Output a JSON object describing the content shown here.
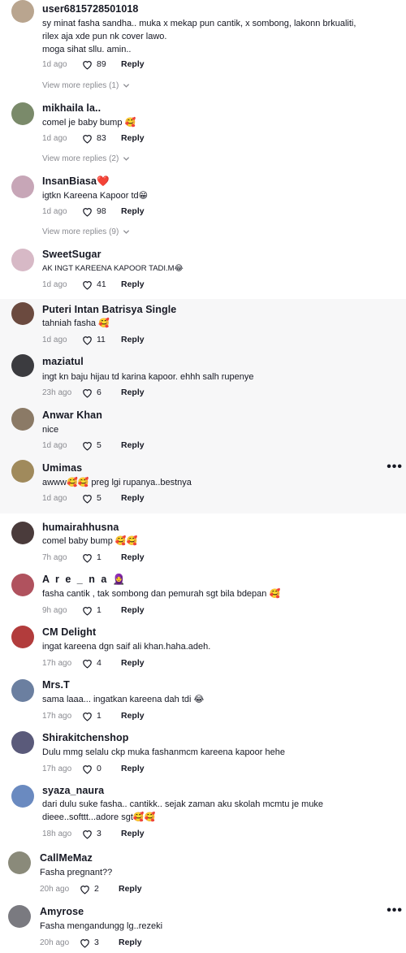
{
  "comments": [
    {
      "username": "user6815728501018",
      "text": "sy minat fasha sandha.. muka x mekap pun cantik, x sombong, lakonn brkualiti,\nrilex aja xde pun nk cover lawo.\nmoga sihat sllu. amin..",
      "time": "1d ago",
      "likes": "89",
      "reply": "Reply",
      "more_replies": "View more replies (1)",
      "avatar_color": "#b9a58f"
    },
    {
      "username": "mikhaila la..",
      "text": "comel je baby bump 🥰",
      "time": "1d ago",
      "likes": "83",
      "reply": "Reply",
      "more_replies": "View more replies (2)",
      "avatar_color": "#7a8a6a"
    },
    {
      "username": "InsanBiasa❤️",
      "text": "igtkn Kareena Kapoor td😁",
      "time": "1d ago",
      "likes": "98",
      "reply": "Reply",
      "more_replies": "View more replies (9)",
      "avatar_color": "#c7a6b7"
    },
    {
      "username": "SweetSugar",
      "text": "AK INGT KAREENA KAPOOR TADI.M😂",
      "time": "1d ago",
      "likes": "41",
      "reply": "Reply",
      "avatar_color": "#d7b9c6"
    },
    {
      "username": "Puteri Intan Batrisya Single",
      "text": "tahniah fasha 🥰",
      "time": "1d ago",
      "likes": "11",
      "reply": "Reply",
      "avatar_color": "#6b4a3f"
    },
    {
      "username": "maziatul",
      "text": "ingt kn baju hijau td karina kapoor. ehhh salh rupenye",
      "time": "23h ago",
      "likes": "6",
      "reply": "Reply",
      "avatar_color": "#3b3b3f"
    },
    {
      "username": "Anwar Khan",
      "text": "nice",
      "time": "1d ago",
      "likes": "5",
      "reply": "Reply",
      "avatar_color": "#8b7a66"
    },
    {
      "username": "Umimas",
      "text": "awww🥰🥰 preg lgi rupanya..bestnya",
      "time": "1d ago",
      "likes": "5",
      "reply": "Reply",
      "avatar_color": "#a08a5c"
    },
    {
      "username": "humairahhusna",
      "text": "comel baby bump 🥰🥰",
      "time": "7h ago",
      "likes": "1",
      "reply": "Reply",
      "avatar_color": "#4a3b3b"
    },
    {
      "username": "A r e _ n a 🧕",
      "text": "fasha cantik , tak sombong dan pemurah sgt bila bdepan 🥰",
      "time": "9h ago",
      "likes": "1",
      "reply": "Reply",
      "avatar_color": "#b0525e"
    },
    {
      "username": "CM Delight",
      "text": "ingat kareena dgn saif ali khan.haha.adeh.",
      "time": "17h ago",
      "likes": "4",
      "reply": "Reply",
      "avatar_color": "#b23c3c"
    },
    {
      "username": "Mrs.T",
      "text": "sama laaa... ingatkan kareena dah tdi 😂",
      "time": "17h ago",
      "likes": "1",
      "reply": "Reply",
      "avatar_color": "#6b7fa0"
    },
    {
      "username": "Shirakitchenshop",
      "text": "Dulu mmg selalu ckp muka fashanmcm kareena kapoor hehe",
      "time": "17h ago",
      "likes": "0",
      "reply": "Reply",
      "avatar_color": "#5a5a7a"
    },
    {
      "username": "syaza_naura",
      "text": "dari dulu suke fasha.. cantikk.. sejak zaman aku skolah mcmtu je muke\ndieee..softtt...adore sgt🥰🥰",
      "time": "18h ago",
      "likes": "3",
      "reply": "Reply",
      "avatar_color": "#6a8ac0"
    },
    {
      "username": "CallMeMaz",
      "text": "Fasha pregnant??",
      "time": "20h ago",
      "likes": "2",
      "reply": "Reply",
      "avatar_color": "#8a8a7a"
    },
    {
      "username": "Amyrose",
      "text": "Fasha mengandungg lg..rezeki",
      "time": "20h ago",
      "likes": "3",
      "reply": "Reply",
      "avatar_color": "#7a7a80"
    }
  ],
  "more_icon": "ellipsis-icon",
  "like_icon": "heart-outline-icon"
}
